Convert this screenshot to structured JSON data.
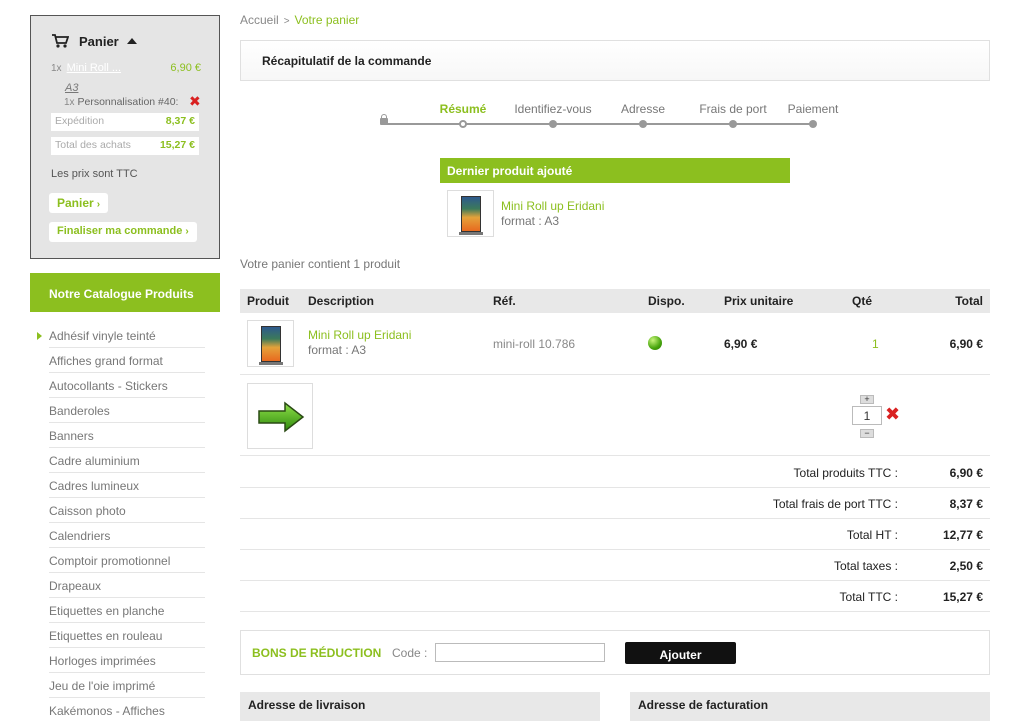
{
  "colors": {
    "accent": "#8cbf1f",
    "danger": "#d92121",
    "button_dark": "#111111"
  },
  "mini_cart": {
    "title": "Panier",
    "item": {
      "qty": "1x",
      "name": "Mini Roll ...",
      "price": "6,90 €",
      "format": "A3"
    },
    "perso": {
      "qty": "1x",
      "label": "Personnalisation #40:"
    },
    "shipping_label": "Expédition",
    "shipping_value": "8,37 €",
    "total_label": "Total des achats",
    "total_value": "15,27 €",
    "ttc_note": "Les prix sont TTC",
    "cart_button": "Panier",
    "checkout_button": "Finaliser ma commande",
    "chevron": "›"
  },
  "catalog": {
    "title": "Notre Catalogue Produits",
    "items": [
      "Adhésif vinyle teinté",
      "Affiches grand format",
      "Autocollants - Stickers",
      "Banderoles",
      "Banners",
      "Cadre aluminium",
      "Cadres lumineux",
      "Caisson photo",
      "Calendriers",
      "Comptoir promotionnel",
      "Drapeaux",
      "Etiquettes en planche",
      "Etiquettes en rouleau",
      "Horloges imprimées",
      "Jeu de l'oie imprimé",
      "Kakémonos - Affiches"
    ]
  },
  "breadcrumb": {
    "home": "Accueil",
    "sep": ">",
    "current": "Votre panier"
  },
  "recap_title": "Récapitulatif de la commande",
  "steps": [
    {
      "label": "Résumé",
      "active": true
    },
    {
      "label": "Identifiez-vous",
      "active": false
    },
    {
      "label": "Adresse",
      "active": false
    },
    {
      "label": "Frais de port",
      "active": false
    },
    {
      "label": "Paiement",
      "active": false
    }
  ],
  "last_added": {
    "title": "Dernier produit ajouté",
    "name": "Mini Roll up Eridani",
    "format": "format : A3"
  },
  "cart_count": "Votre panier contient 1 produit",
  "table": {
    "headers": {
      "product": "Produit",
      "description": "Description",
      "ref": "Réf.",
      "dispo": "Dispo.",
      "unit": "Prix unitaire",
      "qty": "Qté",
      "total": "Total"
    },
    "row": {
      "name": "Mini Roll up Eridani",
      "format": "format : A3",
      "ref": "mini-roll 10.786",
      "unit": "6,90 €",
      "qty": "1",
      "total": "6,90 €"
    },
    "perso": {
      "qty_value": "1",
      "plus": "+",
      "minus": "−"
    }
  },
  "summary": [
    {
      "label": "Total produits TTC :",
      "value": "6,90 €"
    },
    {
      "label": "Total frais de port TTC :",
      "value": "8,37 €"
    },
    {
      "label": "Total HT :",
      "value": "12,77 €"
    },
    {
      "label": "Total taxes :",
      "value": "2,50 €"
    },
    {
      "label": "Total TTC :",
      "value": "15,27 €"
    }
  ],
  "coupon": {
    "title": "BONS DE RÉDUCTION",
    "code_label": "Code :",
    "code_value": "",
    "button": "Ajouter"
  },
  "addresses": {
    "delivery": "Adresse de livraison",
    "billing": "Adresse de facturation"
  }
}
